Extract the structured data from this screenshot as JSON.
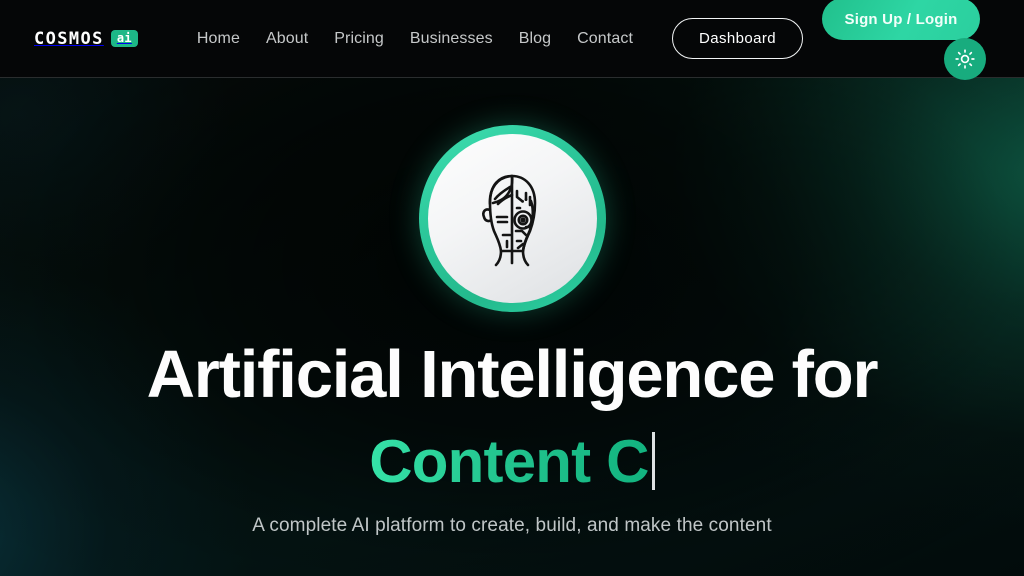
{
  "site": {
    "logo_word": "COSMOS",
    "logo_badge": "ai"
  },
  "header": {
    "nav": [
      {
        "label": "Home"
      },
      {
        "label": "About"
      },
      {
        "label": "Pricing"
      },
      {
        "label": "Businesses"
      },
      {
        "label": "Blog"
      },
      {
        "label": "Contact"
      }
    ],
    "dashboard_label": "Dashboard",
    "signup_label": "Sign Up / Login",
    "theme_toggle_icon": "sun-icon"
  },
  "hero": {
    "avatar_icon": "ai-human-robot-face-icon",
    "headline": "Artificial Intelligence for",
    "typed_text": "Content C",
    "typed_caret": "|",
    "subtitle": "A complete AI platform to create, build, and make the content"
  },
  "colors": {
    "accent_green": "#2ecfa0",
    "accent_green_dark": "#18ac7e",
    "ring_green": "#3fe0b2",
    "background_dark": "#050807",
    "nav_text": "#c6c8c9",
    "headline_text": "#fdfdfd",
    "subtitle_text": "#c0c6c7"
  }
}
